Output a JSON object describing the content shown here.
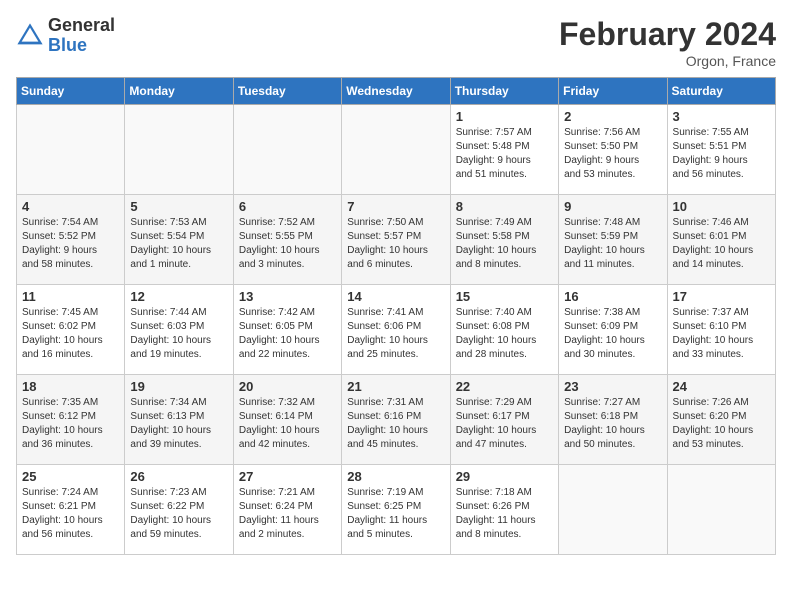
{
  "header": {
    "logo_general": "General",
    "logo_blue": "Blue",
    "title": "February 2024",
    "subtitle": "Orgon, France"
  },
  "days_of_week": [
    "Sunday",
    "Monday",
    "Tuesday",
    "Wednesday",
    "Thursday",
    "Friday",
    "Saturday"
  ],
  "weeks": [
    [
      {
        "num": "",
        "detail": ""
      },
      {
        "num": "",
        "detail": ""
      },
      {
        "num": "",
        "detail": ""
      },
      {
        "num": "",
        "detail": ""
      },
      {
        "num": "1",
        "detail": "Sunrise: 7:57 AM\nSunset: 5:48 PM\nDaylight: 9 hours\nand 51 minutes."
      },
      {
        "num": "2",
        "detail": "Sunrise: 7:56 AM\nSunset: 5:50 PM\nDaylight: 9 hours\nand 53 minutes."
      },
      {
        "num": "3",
        "detail": "Sunrise: 7:55 AM\nSunset: 5:51 PM\nDaylight: 9 hours\nand 56 minutes."
      }
    ],
    [
      {
        "num": "4",
        "detail": "Sunrise: 7:54 AM\nSunset: 5:52 PM\nDaylight: 9 hours\nand 58 minutes."
      },
      {
        "num": "5",
        "detail": "Sunrise: 7:53 AM\nSunset: 5:54 PM\nDaylight: 10 hours\nand 1 minute."
      },
      {
        "num": "6",
        "detail": "Sunrise: 7:52 AM\nSunset: 5:55 PM\nDaylight: 10 hours\nand 3 minutes."
      },
      {
        "num": "7",
        "detail": "Sunrise: 7:50 AM\nSunset: 5:57 PM\nDaylight: 10 hours\nand 6 minutes."
      },
      {
        "num": "8",
        "detail": "Sunrise: 7:49 AM\nSunset: 5:58 PM\nDaylight: 10 hours\nand 8 minutes."
      },
      {
        "num": "9",
        "detail": "Sunrise: 7:48 AM\nSunset: 5:59 PM\nDaylight: 10 hours\nand 11 minutes."
      },
      {
        "num": "10",
        "detail": "Sunrise: 7:46 AM\nSunset: 6:01 PM\nDaylight: 10 hours\nand 14 minutes."
      }
    ],
    [
      {
        "num": "11",
        "detail": "Sunrise: 7:45 AM\nSunset: 6:02 PM\nDaylight: 10 hours\nand 16 minutes."
      },
      {
        "num": "12",
        "detail": "Sunrise: 7:44 AM\nSunset: 6:03 PM\nDaylight: 10 hours\nand 19 minutes."
      },
      {
        "num": "13",
        "detail": "Sunrise: 7:42 AM\nSunset: 6:05 PM\nDaylight: 10 hours\nand 22 minutes."
      },
      {
        "num": "14",
        "detail": "Sunrise: 7:41 AM\nSunset: 6:06 PM\nDaylight: 10 hours\nand 25 minutes."
      },
      {
        "num": "15",
        "detail": "Sunrise: 7:40 AM\nSunset: 6:08 PM\nDaylight: 10 hours\nand 28 minutes."
      },
      {
        "num": "16",
        "detail": "Sunrise: 7:38 AM\nSunset: 6:09 PM\nDaylight: 10 hours\nand 30 minutes."
      },
      {
        "num": "17",
        "detail": "Sunrise: 7:37 AM\nSunset: 6:10 PM\nDaylight: 10 hours\nand 33 minutes."
      }
    ],
    [
      {
        "num": "18",
        "detail": "Sunrise: 7:35 AM\nSunset: 6:12 PM\nDaylight: 10 hours\nand 36 minutes."
      },
      {
        "num": "19",
        "detail": "Sunrise: 7:34 AM\nSunset: 6:13 PM\nDaylight: 10 hours\nand 39 minutes."
      },
      {
        "num": "20",
        "detail": "Sunrise: 7:32 AM\nSunset: 6:14 PM\nDaylight: 10 hours\nand 42 minutes."
      },
      {
        "num": "21",
        "detail": "Sunrise: 7:31 AM\nSunset: 6:16 PM\nDaylight: 10 hours\nand 45 minutes."
      },
      {
        "num": "22",
        "detail": "Sunrise: 7:29 AM\nSunset: 6:17 PM\nDaylight: 10 hours\nand 47 minutes."
      },
      {
        "num": "23",
        "detail": "Sunrise: 7:27 AM\nSunset: 6:18 PM\nDaylight: 10 hours\nand 50 minutes."
      },
      {
        "num": "24",
        "detail": "Sunrise: 7:26 AM\nSunset: 6:20 PM\nDaylight: 10 hours\nand 53 minutes."
      }
    ],
    [
      {
        "num": "25",
        "detail": "Sunrise: 7:24 AM\nSunset: 6:21 PM\nDaylight: 10 hours\nand 56 minutes."
      },
      {
        "num": "26",
        "detail": "Sunrise: 7:23 AM\nSunset: 6:22 PM\nDaylight: 10 hours\nand 59 minutes."
      },
      {
        "num": "27",
        "detail": "Sunrise: 7:21 AM\nSunset: 6:24 PM\nDaylight: 11 hours\nand 2 minutes."
      },
      {
        "num": "28",
        "detail": "Sunrise: 7:19 AM\nSunset: 6:25 PM\nDaylight: 11 hours\nand 5 minutes."
      },
      {
        "num": "29",
        "detail": "Sunrise: 7:18 AM\nSunset: 6:26 PM\nDaylight: 11 hours\nand 8 minutes."
      },
      {
        "num": "",
        "detail": ""
      },
      {
        "num": "",
        "detail": ""
      }
    ]
  ]
}
